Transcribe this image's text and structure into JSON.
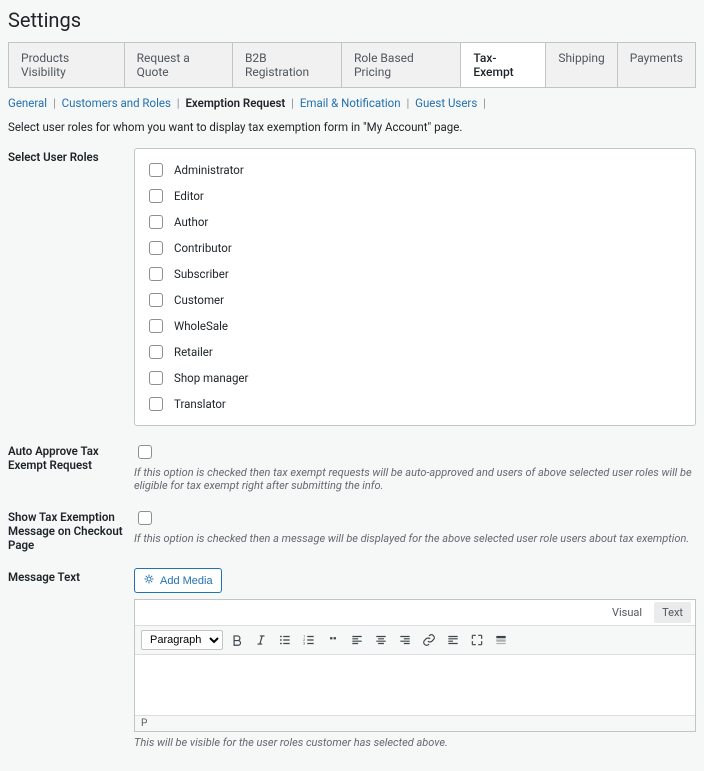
{
  "page": {
    "title": "Settings"
  },
  "tabs": {
    "products_visibility": "Products Visibility",
    "request_quote": "Request a Quote",
    "b2b_registration": "B2B Registration",
    "role_pricing": "Role Based Pricing",
    "tax_exempt": "Tax-Exempt",
    "shipping": "Shipping",
    "payments": "Payments"
  },
  "subnav": {
    "general": "General",
    "customers_roles": "Customers and Roles",
    "exemption_request": "Exemption Request",
    "email_notification": "Email & Notification",
    "guest_users": "Guest Users"
  },
  "description": "Select user roles for whom you want to display tax exemption form in \"My Account\" page.",
  "labels": {
    "select_user_roles": "Select User Roles",
    "auto_approve": "Auto Approve Tax Exempt Request",
    "show_exemption_msg": "Show Tax Exemption Message on Checkout Page",
    "message_text": "Message Text"
  },
  "roles": [
    "Administrator",
    "Editor",
    "Author",
    "Contributor",
    "Subscriber",
    "Customer",
    "WholeSale",
    "Retailer",
    "Shop manager",
    "Translator"
  ],
  "help": {
    "auto_approve": "If this option is checked then tax exempt requests will be auto-approved and users of above selected user roles will be eligible for tax exempt right after submitting the info.",
    "show_exemption_msg": "If this option is checked then a message will be displayed for the above selected user role users about tax exemption.",
    "message_text": "This will be visible for the user roles customer has selected above."
  },
  "editor": {
    "add_media": "Add Media",
    "tab_visual": "Visual",
    "tab_text": "Text",
    "format_select": "Paragraph",
    "status_path": "P"
  }
}
